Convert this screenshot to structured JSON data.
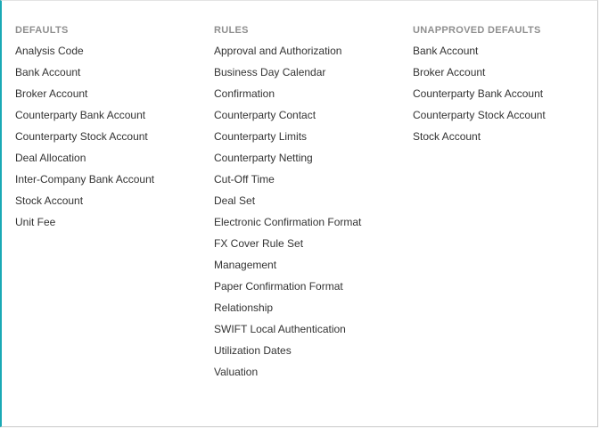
{
  "columns": {
    "defaults": {
      "heading": "DEFAULTS",
      "items": [
        "Analysis Code",
        "Bank Account",
        "Broker Account",
        "Counterparty Bank Account",
        "Counterparty Stock Account",
        "Deal Allocation",
        "Inter-Company Bank Account",
        "Stock Account",
        "Unit Fee"
      ]
    },
    "rules": {
      "heading": "RULES",
      "items": [
        "Approval and Authorization",
        "Business Day Calendar",
        "Confirmation",
        "Counterparty Contact",
        "Counterparty Limits",
        "Counterparty Netting",
        "Cut-Off Time",
        "Deal Set",
        "Electronic Confirmation Format",
        "FX Cover Rule Set",
        "Management",
        "Paper Confirmation Format",
        "Relationship",
        "SWIFT Local Authentication",
        "Utilization Dates",
        "Valuation"
      ]
    },
    "unapproved": {
      "heading": "UNAPPROVED DEFAULTS",
      "items": [
        "Bank Account",
        "Broker Account",
        "Counterparty Bank Account",
        "Counterparty Stock Account",
        "Stock Account"
      ]
    }
  },
  "colors": {
    "accent": "#1aa9b5",
    "heading": "#8f8f8f",
    "text": "#333333"
  }
}
